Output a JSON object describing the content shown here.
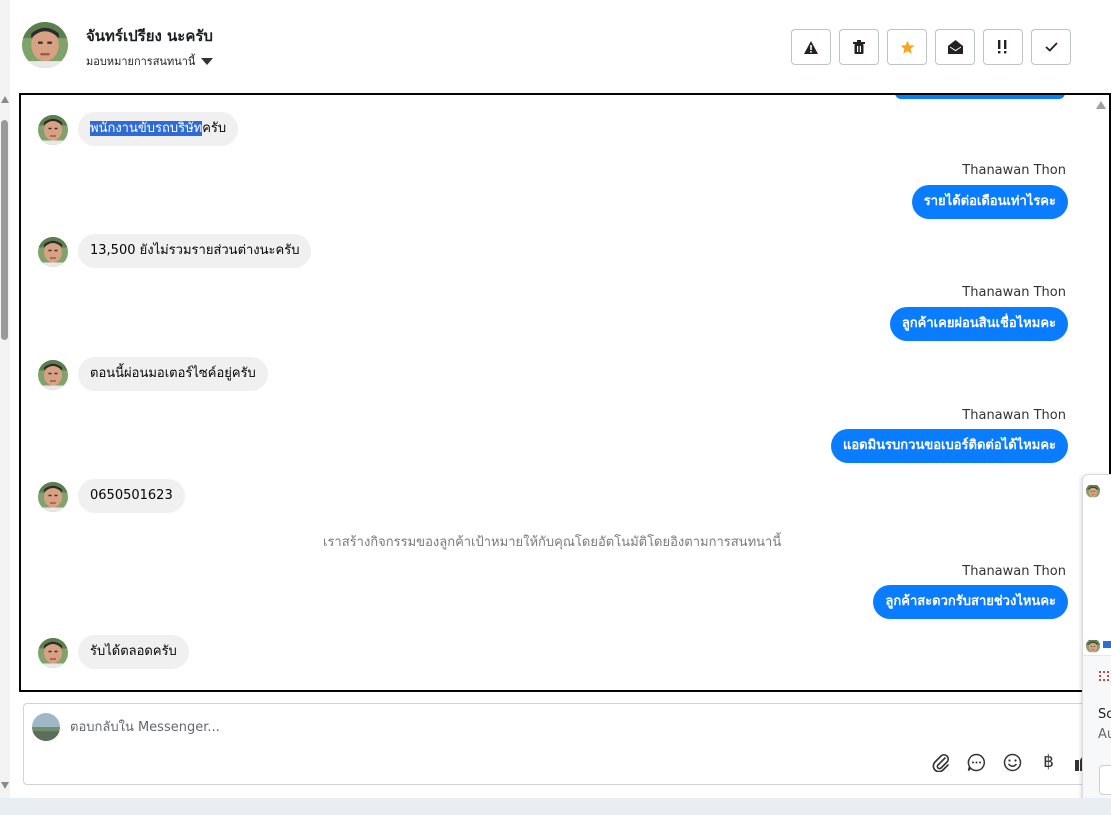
{
  "header": {
    "contact_name": "จันทร์เปรียง นะครับ",
    "assign_label": "มอบหมายการสนทนานี้",
    "toolbar": [
      {
        "name": "report-button",
        "icon": "warning-icon"
      },
      {
        "name": "delete-button",
        "icon": "trash-icon"
      },
      {
        "name": "star-button",
        "icon": "star-icon"
      },
      {
        "name": "mark-unread-button",
        "icon": "envelope-open-icon"
      },
      {
        "name": "follow-up-button",
        "icon": "follow-up-icon"
      },
      {
        "name": "mark-done-button",
        "icon": "check-icon"
      }
    ]
  },
  "messages": {
    "m1": {
      "prefix": "พนักงานขับรถบริษัท",
      "suffix": "ครับ"
    },
    "m2": {
      "sender": "Thanawan Thon",
      "text": "รายได้ต่อเดือนเท่าไรคะ"
    },
    "m3": {
      "text": "13,500 ยังไม่รวมรายส่วนต่างนะครับ"
    },
    "m4": {
      "sender": "Thanawan Thon",
      "text": "ลูกค้าเคยผ่อนสินเชื่อไหมคะ"
    },
    "m5": {
      "text": "ตอนนี้ผ่อนมอเตอร์ไซค์อยู่ครับ"
    },
    "m6": {
      "sender": "Thanawan Thon",
      "text": "แอดมินรบกวนขอเบอร์ติดต่อได้ไหมคะ"
    },
    "m7": {
      "text": "0650501623"
    },
    "system_note": "เราสร้างกิจกรรมของลูกค้าเป้าหมายให้กับคุณโดยอัตโนมัติโดยอิงตามการสนทนานี้",
    "m8": {
      "sender": "Thanawan Thon",
      "text": "ลูกค้าสะดวกรับสายช่วงไหนคะ"
    },
    "m9": {
      "text": "รับได้ตลอดครับ"
    }
  },
  "composer": {
    "placeholder": "ตอบกลับใน Messenger...",
    "icons": [
      "paperclip-icon",
      "saved-replies-icon",
      "emoji-icon",
      "baht-icon",
      "thumbs-up-icon"
    ],
    "baht_glyph": "฿"
  },
  "side_popup": {
    "label_1": "Sc",
    "label_2": "Au"
  },
  "colors": {
    "outgoing_bubble": "#0a7cff",
    "incoming_bubble": "#f0f0f0",
    "star": "#f5a623",
    "selection": "#2e6bd8"
  }
}
